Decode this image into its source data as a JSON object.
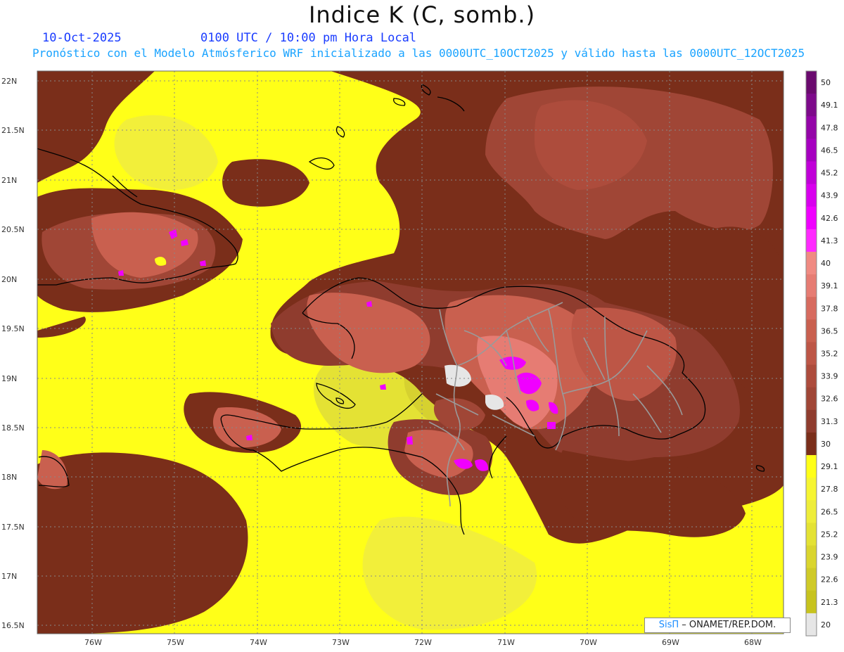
{
  "header": {
    "title": "Indice K (C, somb.)",
    "date": "10-Oct-2025",
    "time": "0100 UTC / 10:00 pm Hora Local",
    "forecast_note": "Pronóstico con el Modelo Atmósferico WRF inicializado a las 0000UTC_10OCT2025 y válido hasta las  0000UTC_12OCT2025"
  },
  "map": {
    "lat_labels": [
      "22N",
      "21.5N",
      "21N",
      "20.5N",
      "20N",
      "19.5N",
      "19N",
      "18.5N",
      "18N",
      "17.5N",
      "17N",
      "16.5N"
    ],
    "lon_labels": [
      "76W",
      "75W",
      "74W",
      "73W",
      "72W",
      "71W",
      "70W",
      "69W",
      "68W"
    ]
  },
  "colorbar": {
    "labels": [
      "50",
      "49.1",
      "47.8",
      "46.5",
      "45.2",
      "43.9",
      "42.6",
      "41.3",
      "40",
      "39.1",
      "37.8",
      "36.5",
      "35.2",
      "33.9",
      "32.6",
      "31.3",
      "30",
      "29.1",
      "27.8",
      "26.5",
      "25.2",
      "23.9",
      "22.6",
      "21.3",
      "20"
    ],
    "colors": [
      "#6a0a6e",
      "#7d0a8a",
      "#9405a8",
      "#a600c0",
      "#c000d8",
      "#d800ee",
      "#f000ff",
      "#ff2aff",
      "#f08a82",
      "#e67c73",
      "#d76b5f",
      "#c9604f",
      "#bd5646",
      "#ad4c3c",
      "#a04636",
      "#8f3c2e",
      "#7a2e1a",
      "#ffff18",
      "#f6f532",
      "#eeed3a",
      "#e4e234",
      "#dad52e",
      "#cfca28",
      "#c7c31e",
      "#e6e6e6"
    ]
  },
  "credit": {
    "brand": "SisΠ",
    "org": "– ONAMET/REP.DOM."
  }
}
